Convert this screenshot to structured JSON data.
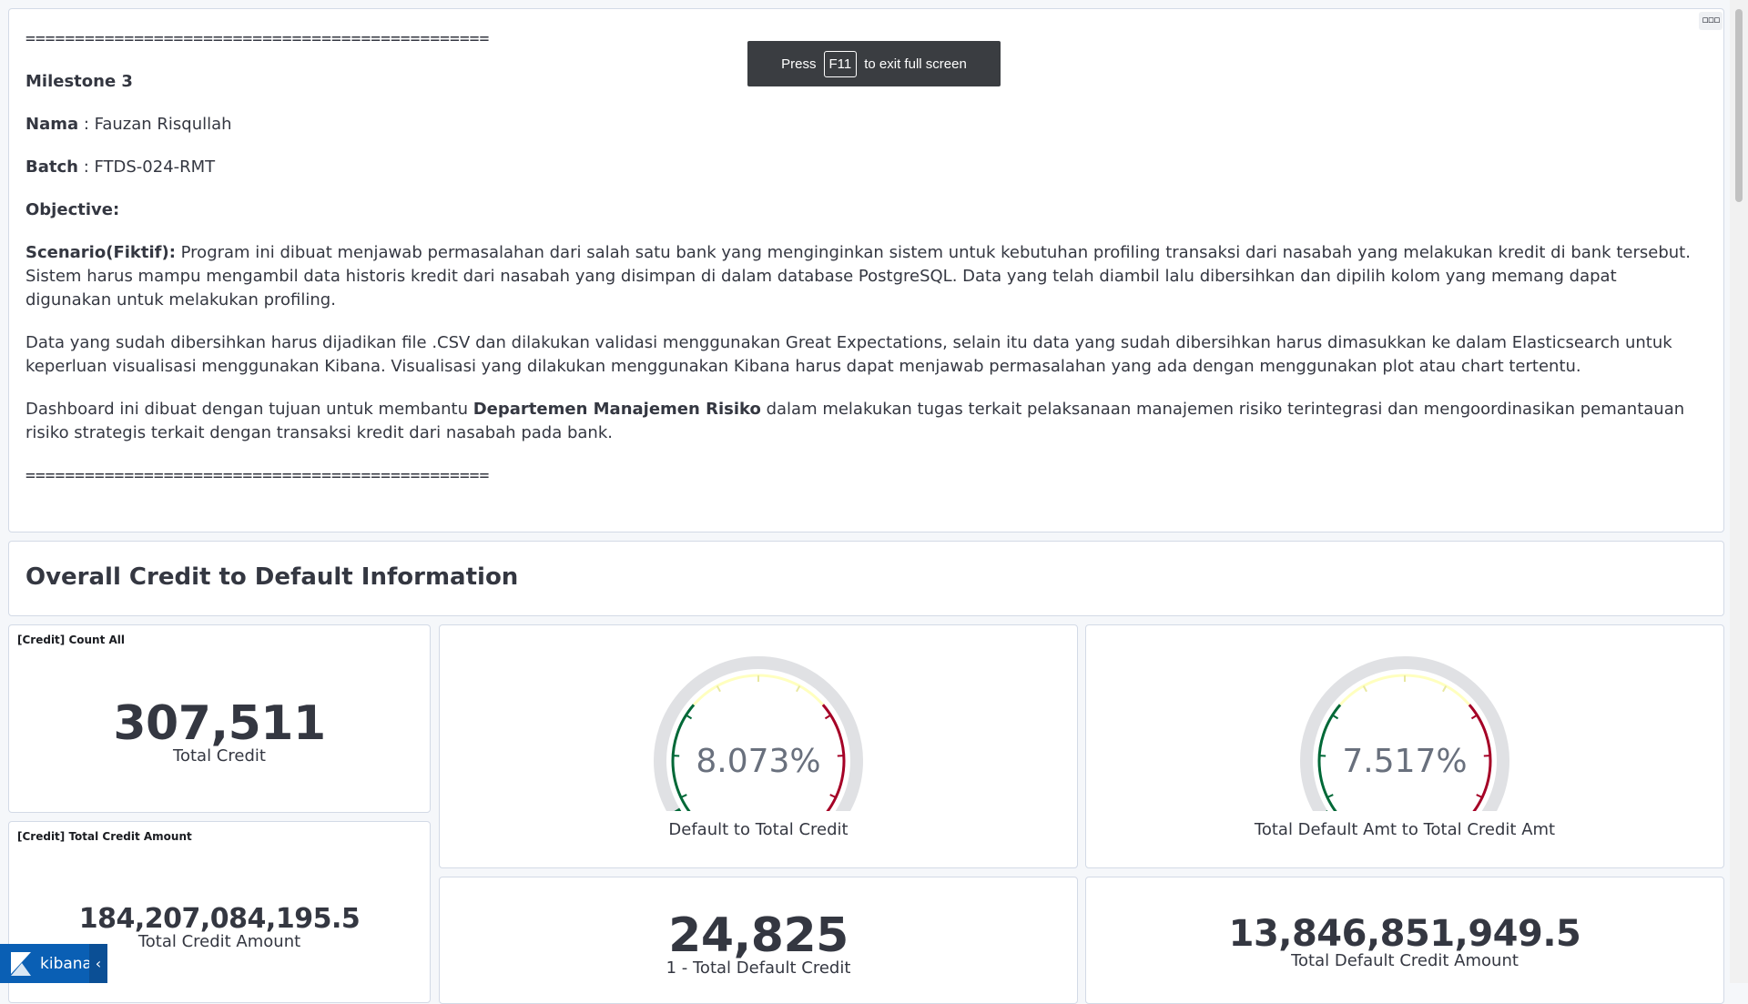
{
  "markdown": {
    "rule_top": "===============================================",
    "milestone": "Milestone 3",
    "nama_label": "Nama",
    "nama_value": " : Fauzan Risqullah",
    "batch_label": "Batch",
    "batch_value": " : FTDS-024-RMT",
    "objective_label": "Objective:",
    "scenario_label": "Scenario(Fiktif):",
    "scenario_text": " Program ini dibuat menjawab permasalahan dari salah satu bank yang menginginkan sistem untuk kebutuhan profiling transaksi dari nasabah yang melakukan kredit di bank tersebut. Sistem harus mampu mengambil data historis kredit dari nasabah yang disimpan di dalam database PostgreSQL. Data yang telah diambil lalu dibersihkan dan dipilih kolom yang memang dapat digunakan untuk melakukan profiling.",
    "paragraph2": "Data yang sudah dibersihkan harus dijadikan file .CSV dan dilakukan validasi menggunakan Great Expectations, selain itu data yang sudah dibersihkan harus dimasukkan ke dalam Elasticsearch untuk keperluan visualisasi menggunakan Kibana. Visualisasi yang dilakukan menggunakan Kibana harus dapat menjawab permasalahan yang ada dengan menggunakan plot atau chart tertentu.",
    "paragraph3_pre": "Dashboard ini dibuat dengan tujuan untuk membantu ",
    "paragraph3_bold": "Departemen Manajemen Risiko",
    "paragraph3_post": " dalam melakukan tugas terkait pelaksanaan manajemen risiko terintegrasi dan mengoordinasikan pemantauan risiko strategis terkait dengan transaksi kredit dari nasabah pada bank.",
    "rule_bottom": "==============================================="
  },
  "panel_menu_icon": "ellipsis-icon",
  "fullscreen_toast": {
    "press": "Press",
    "key": "F11",
    "suffix": "to exit full screen"
  },
  "header": {
    "title": "Overall Credit to Default Information"
  },
  "count_panel": {
    "title": "[Credit] Count All",
    "value": "307,511",
    "label": "Total Credit"
  },
  "amount_panel": {
    "title": "[Credit] Total Credit Amount",
    "value": "184,207,084,195.5",
    "label": "Total Credit Amount"
  },
  "gauge1": {
    "value_text": "8.073%",
    "value": 8.073,
    "label": "Default to Total Credit"
  },
  "gauge2": {
    "value_text": "7.517%",
    "value": 7.517,
    "label": "Total Default Amt to Total Credit Amt"
  },
  "default_panel": {
    "value": "24,825",
    "label": "1 - Total Default Credit"
  },
  "defamt_panel": {
    "value": "13,846,851,949.5",
    "label": "Total Default Credit Amount"
  },
  "colors": {
    "green": "#006837",
    "yellow": "#ffffbf",
    "red": "#a50026",
    "track": "#e0e1e4"
  },
  "kibana_badge": {
    "name": "kibana",
    "collapse": "‹"
  }
}
